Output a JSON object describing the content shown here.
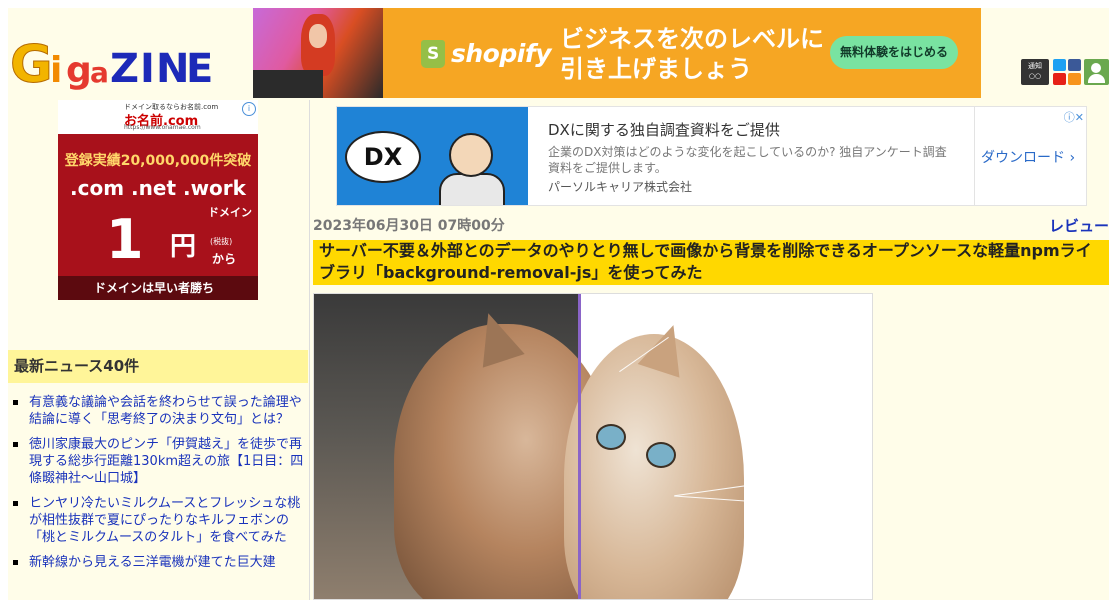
{
  "header": {
    "logo": {
      "text": "GigaZINE"
    },
    "banner": {
      "brand": "shopify",
      "headline": "ビジネスを次のレベルに引き上げましょう",
      "cta": "無料体験をはじめる"
    },
    "notify_label": "通知",
    "icons": [
      "notification-icon",
      "twitter-icon",
      "facebook-icon",
      "youtube-icon",
      "rss-icon",
      "user-icon"
    ]
  },
  "left_ad": {
    "top_line": "ドメイン取るならお名前.com",
    "brand": "お名前.com",
    "url": "https://www.onamae.com",
    "badge": "登録実績20,000,000件突破",
    "domains": ".com .net .work",
    "price": "1",
    "yen": "円",
    "domain_label": "ドメイン",
    "tax": "(税抜)",
    "kara": "から",
    "slogan": "ドメインは早い者勝ち"
  },
  "sidebar": {
    "news_heading": "最新ニュース40件",
    "news": [
      "有意義な議論や会話を終わらせて誤った論理や結論に導く「思考終了の決まり文句」とは？",
      "徳川家康最大のピンチ「伊賀越え」を徒歩で再現する総歩行距離130km超えの旅【1日目：四條畷神社〜山口城】",
      "ヒンヤリ冷たいミルクムースとフレッシュな桃が相性抜群で夏にぴったりなキルフェボンの「桃とミルクムースのタルト」を食べてみた",
      "新幹線から見える三洋電機が建てた巨大建"
    ]
  },
  "dx_ad": {
    "cloud_text": "DX",
    "title": "DXに関する独自調査資料をご提供",
    "desc": "企業のDX対策はどのような変化を起こしているのか? 独自アンケート調査資料をご提供します。",
    "company": "パーソルキャリア株式会社",
    "download": "ダウンロード",
    "icons": "ⓘ✕"
  },
  "article": {
    "date": "2023年06月30日 07時00分",
    "category": "レビュー",
    "title": "サーバー不要＆外部とのデータのやりとり無しで画像から背景を削除できるオープンソースな軽量npmライブラリ「background-removal-js」を使ってみた"
  },
  "colors": {
    "page_bg": "#fffde9",
    "title_bg": "#ffd800",
    "news_heading_bg": "#fff599",
    "link": "#1a33bb"
  }
}
